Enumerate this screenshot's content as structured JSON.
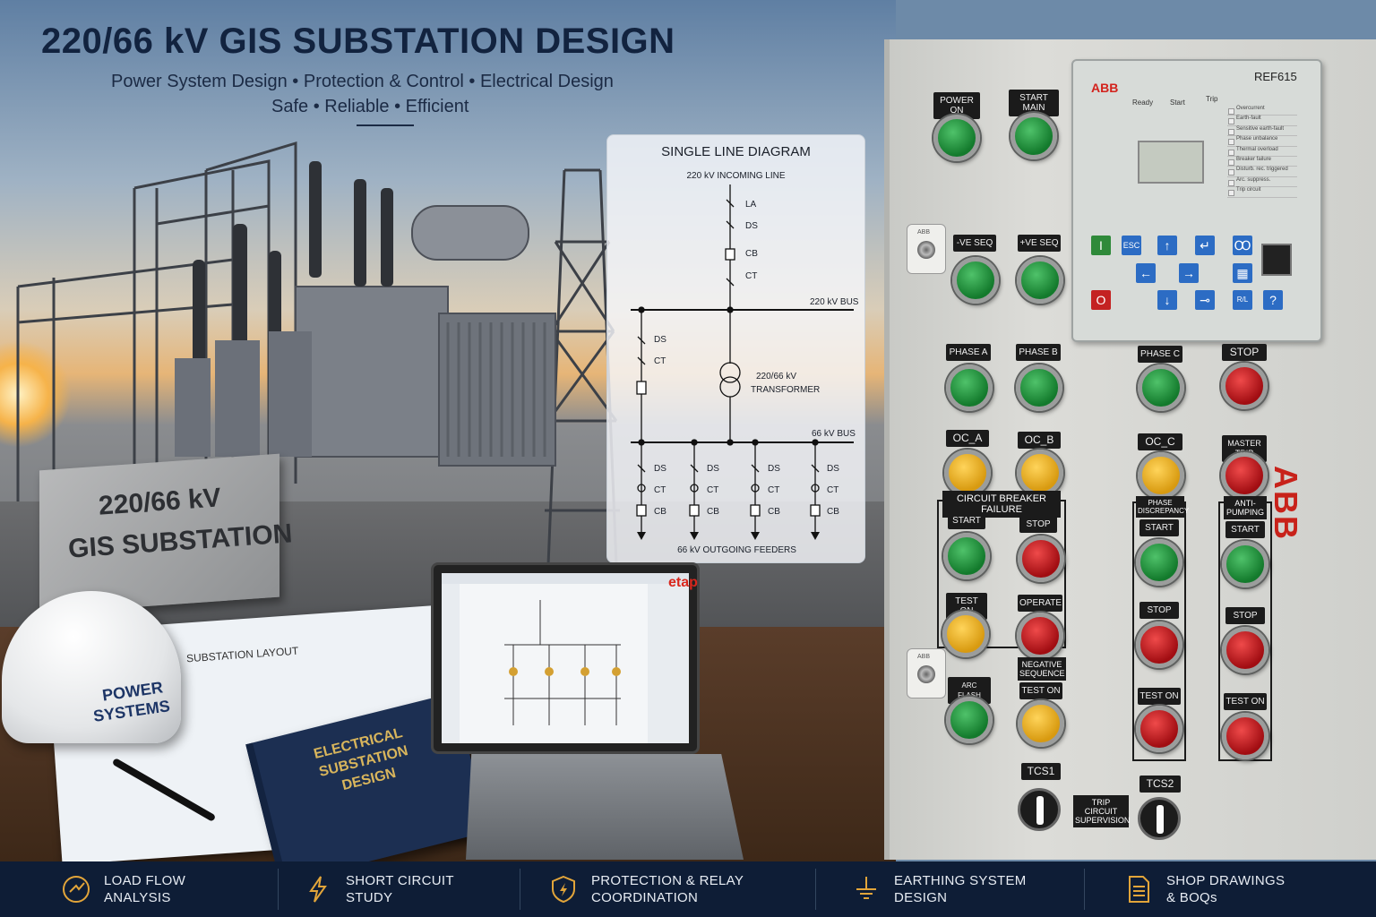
{
  "header": {
    "title": "220/66 kV GIS SUBSTATION DESIGN",
    "subtitle_line1": "Power System Design  •  Protection & Control  •  Electrical Design",
    "subtitle_line2": "Safe  •  Reliable  •  Efficient"
  },
  "plinth": {
    "line1": "220/66 kV",
    "line2": "GIS SUBSTATION"
  },
  "sld": {
    "title": "SINGLE LINE DIAGRAM",
    "incoming": "220 kV INCOMING LINE",
    "la": "LA",
    "ds": "DS",
    "cb": "CB",
    "ct": "CT",
    "bus_220": "220 kV BUS",
    "transformer_1": "220/66 kV",
    "transformer_2": "TRANSFORMER",
    "bus_66": "66 kV BUS",
    "feeders": "66 kV OUTGOING FEEDERS"
  },
  "desk": {
    "blueprint_title": "SUBSTATION LAYOUT",
    "helmet_1": "POWER",
    "helmet_2": "SYSTEMS",
    "book_1": "ELECTRICAL",
    "book_2": "SUBSTATION",
    "book_3": "DESIGN",
    "laptop_brand": "etap"
  },
  "relay": {
    "brand": "ABB",
    "model": "REF615",
    "hdr_ready": "Ready",
    "hdr_start": "Start",
    "hdr_trip": "Trip",
    "leds": [
      "Overcurrent",
      "Earth-fault",
      "Sensitive earth-fault",
      "Phase unbalance",
      "Thermal overload",
      "Breaker failure",
      "Disturb. rec. triggered",
      "Arc. suppress.",
      "Trip circuit"
    ],
    "key_i": "I",
    "key_o": "O",
    "key_esc": "ESC",
    "key_up": "↑",
    "key_enter": "↵",
    "key_menu": "Ꝏ",
    "key_left": "←",
    "key_right": "→",
    "key_down": "↓",
    "key_key": "⊸",
    "key_rl": "R/L",
    "key_help": "?",
    "key_clear": "▦"
  },
  "panel": {
    "power_on": "POWER ON",
    "start_main": "START MAIN",
    "neg_seq": "-VE SEQ",
    "pos_seq": "+VE SEQ",
    "phase_a": "PHASE A",
    "phase_b": "PHASE B",
    "phase_c": "PHASE C",
    "stop": "STOP",
    "oc_a": "OC_A",
    "oc_b": "OC_B",
    "oc_c": "OC_C",
    "master_trip": "MASTER TRIP",
    "cbf": "CIRCUIT BREAKER FAILURE",
    "phase_disc_1": "PHASE",
    "phase_disc_2": "DISCREPANCY",
    "anti_pump_1": "ANTI-",
    "anti_pump_2": "PUMPING",
    "start": "START",
    "test_on": "TEST ON",
    "operate": "OPERATE",
    "neg_sequence_1": "NEGATIVE",
    "neg_sequence_2": "SEQUENCE",
    "arc_flash": "ARC FLASH",
    "keylock": "ABB",
    "tcs1": "TCS1",
    "tcs2": "TCS2",
    "tcs_1": "TRIP CIRCUIT",
    "tcs_2": "SUPERVISION",
    "side_brand": "ABB"
  },
  "footer": [
    {
      "l1": "LOAD FLOW",
      "l2": "ANALYSIS",
      "icon": "load-flow-icon"
    },
    {
      "l1": "SHORT CIRCUIT",
      "l2": "STUDY",
      "icon": "lightning-icon"
    },
    {
      "l1": "PROTECTION & RELAY",
      "l2": "COORDINATION",
      "icon": "shield-icon"
    },
    {
      "l1": "EARTHING SYSTEM",
      "l2": "DESIGN",
      "icon": "earth-icon"
    },
    {
      "l1": "SHOP DRAWINGS",
      "l2": "& BOQs",
      "icon": "document-icon"
    }
  ],
  "colors": {
    "navy": "#0e1d36",
    "accent": "#e2a53a",
    "abb_red": "#d3221c"
  }
}
